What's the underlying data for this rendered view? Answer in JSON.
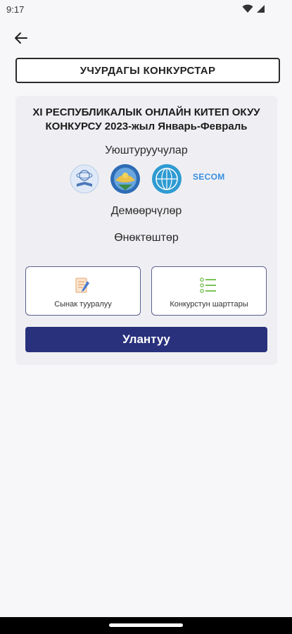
{
  "status_bar": {
    "time": "9:17"
  },
  "header": {
    "title": "УЧУРДАГЫ КОНКУРСТАР"
  },
  "contest": {
    "title_line1": "XI РЕСПУБЛИКАЛЫК ОНЛАЙН КИТЕП ОКУУ",
    "title_line2": "КОНКУРСУ 2023-жыл Январь-Февраль",
    "organizers_label": "Уюштуруучулар",
    "sponsors_label": "Демөөрчүлөр",
    "helpers_label": "Өнөктөштөр",
    "organizer_logos": [
      "academy-logo-icon",
      "kyrgyz-emblem-icon",
      "globe-emblem-icon",
      "secom-logo"
    ],
    "secom_text": "SECOM",
    "tiles": [
      {
        "label": "Сынак тууралуу",
        "icon": "document-pen-icon"
      },
      {
        "label": "Конкурстун шарттары",
        "icon": "checklist-icon"
      }
    ],
    "join_label": "Улантуу"
  },
  "colors": {
    "primary": "#29317d",
    "accent_green": "#7cc35a",
    "accent_blue": "#3a8ee0"
  }
}
